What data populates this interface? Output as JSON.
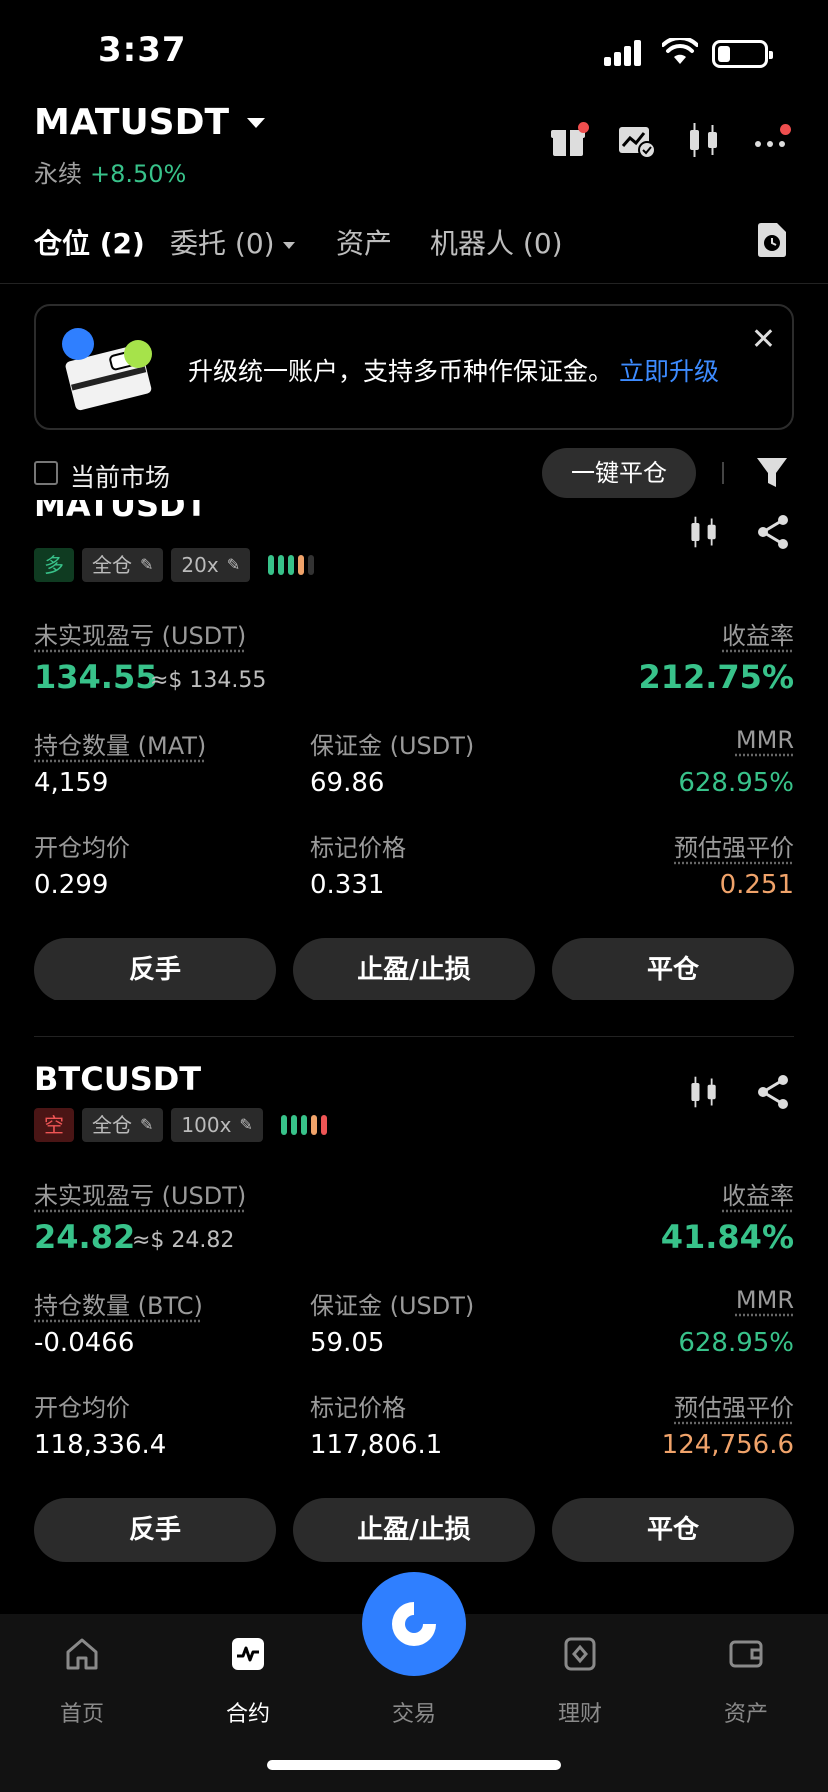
{
  "status_bar": {
    "time": "3:37"
  },
  "header": {
    "symbol": "MATUSDT",
    "contract_type": "永续",
    "change": "+8.50%"
  },
  "tabs": [
    {
      "label": "仓位 (2)"
    },
    {
      "label": "委托 (0)"
    },
    {
      "label": "资产"
    },
    {
      "label": "机器人 (0)"
    }
  ],
  "banner": {
    "text": "升级统一账户，支持多币种作保证金。",
    "link": "立即升级",
    "close": "✕"
  },
  "filter": {
    "checkbox_label": "当前市场",
    "close_all": "一键平仓"
  },
  "positions": [
    {
      "symbol": "MATUSDT",
      "side": "多",
      "margin_mode": "全仓",
      "leverage": "20x",
      "pnl_label": "未实现盈亏 (USDT)",
      "pnl": "134.55",
      "pnl_usd": "≈$ 134.55",
      "roe_label": "收益率",
      "roe": "212.75%",
      "size_label": "持仓数量 (MAT)",
      "size": "4,159",
      "margin_label": "保证金 (USDT)",
      "margin": "69.86",
      "mmr_label": "MMR",
      "mmr": "628.95%",
      "entry_label": "开仓均价",
      "entry": "0.299",
      "mark_label": "标记价格",
      "mark": "0.331",
      "liq_label": "预估强平价",
      "liq": "0.251",
      "btn_reverse": "反手",
      "btn_tpsl": "止盈/止损",
      "btn_close": "平仓"
    },
    {
      "symbol": "BTCUSDT",
      "side": "空",
      "margin_mode": "全仓",
      "leverage": "100x",
      "pnl_label": "未实现盈亏 (USDT)",
      "pnl": "24.82",
      "pnl_usd": "≈$ 24.82",
      "roe_label": "收益率",
      "roe": "41.84%",
      "size_label": "持仓数量 (BTC)",
      "size": "-0.0466",
      "margin_label": "保证金 (USDT)",
      "margin": "59.05",
      "mmr_label": "MMR",
      "mmr": "628.95%",
      "entry_label": "开仓均价",
      "entry": "118,336.4",
      "mark_label": "标记价格",
      "mark": "117,806.1",
      "liq_label": "预估强平价",
      "liq": "124,756.6",
      "btn_reverse": "反手",
      "btn_tpsl": "止盈/止损",
      "btn_close": "平仓"
    }
  ],
  "bottom_nav": [
    {
      "label": "首页",
      "icon": "home-icon"
    },
    {
      "label": "合约",
      "icon": "futures-chart-icon"
    },
    {
      "label": "交易",
      "icon": "trade-icon"
    },
    {
      "label": "理财",
      "icon": "earn-icon"
    },
    {
      "label": "资产",
      "icon": "wallet-icon"
    }
  ],
  "colors": {
    "green": "#38c28a",
    "red": "#ee5555",
    "orange": "#f0a36a",
    "blue": "#2f7fff"
  }
}
